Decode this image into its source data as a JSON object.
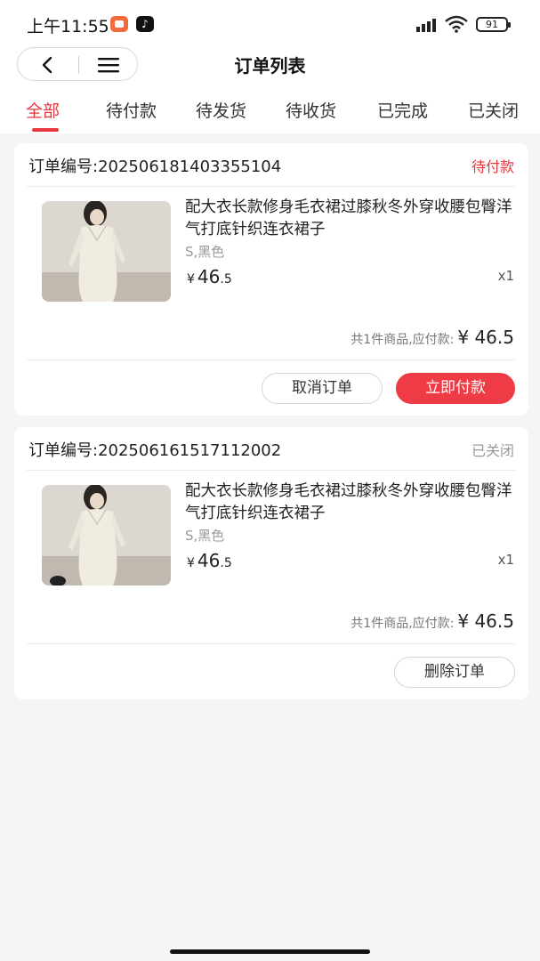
{
  "status_bar": {
    "time": "上午11:55",
    "battery": "91",
    "app_icons": [
      "photo-app-icon",
      "tiktok-icon"
    ]
  },
  "nav": {
    "title": "订单列表"
  },
  "tabs": [
    {
      "label": "全部",
      "active": true
    },
    {
      "label": "待付款",
      "active": false
    },
    {
      "label": "待发货",
      "active": false
    },
    {
      "label": "待收货",
      "active": false
    },
    {
      "label": "已完成",
      "active": false
    },
    {
      "label": "已关闭",
      "active": false
    }
  ],
  "colors": {
    "accent": "#e8363e",
    "pay_button": "#ee3b46",
    "status_closed": "#999999"
  },
  "orders": [
    {
      "order_no": "订单编号:202506181403355104",
      "status": "待付款",
      "status_color": "#e8363e",
      "product_title": "配大衣长款修身毛衣裙过膝秋冬外穿收腰包臀洋气打底针织连衣裙子",
      "spec": "S,黑色",
      "price_yen": "¥",
      "price_int": "46",
      "price_dec": ".5",
      "qty": "x1",
      "summary_label": "共1件商品,应付款:",
      "summary_amount": "¥ 46.5",
      "buttons": [
        {
          "label": "取消订单",
          "style": "outline"
        },
        {
          "label": "立即付款",
          "style": "primary"
        }
      ]
    },
    {
      "order_no": "订单编号:202506161517112002",
      "status": "已关闭",
      "status_color": "#999999",
      "product_title": "配大衣长款修身毛衣裙过膝秋冬外穿收腰包臀洋气打底针织连衣裙子",
      "spec": "S,黑色",
      "price_yen": "¥",
      "price_int": "46",
      "price_dec": ".5",
      "qty": "x1",
      "summary_label": "共1件商品,应付款:",
      "summary_amount": "¥ 46.5",
      "buttons": [
        {
          "label": "删除订单",
          "style": "outline"
        }
      ]
    }
  ]
}
